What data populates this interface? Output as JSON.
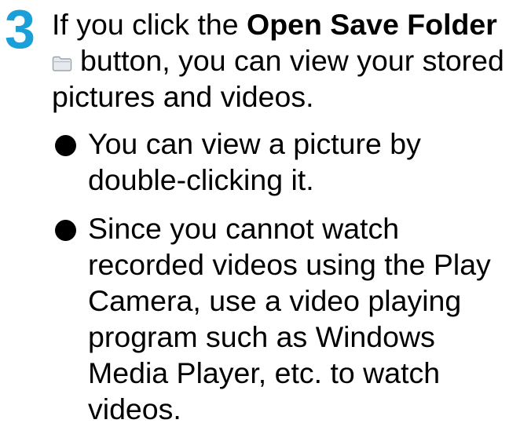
{
  "step": {
    "number": "3",
    "text_before": "If you click the ",
    "bold_label": "Open Save Folder",
    "icon": "folder-icon",
    "text_after": "button, you can view your stored pictures and videos."
  },
  "bullets": [
    "You can view a picture by double-clicking it.",
    "Since you cannot watch recorded videos using the Play Camera, use a video playing program such as Windows Media Player, etc. to watch videos."
  ],
  "colors": {
    "step_number": "#1a9fd9",
    "icon_fill": "#e6eaee",
    "icon_stroke": "#9aa4ad"
  }
}
